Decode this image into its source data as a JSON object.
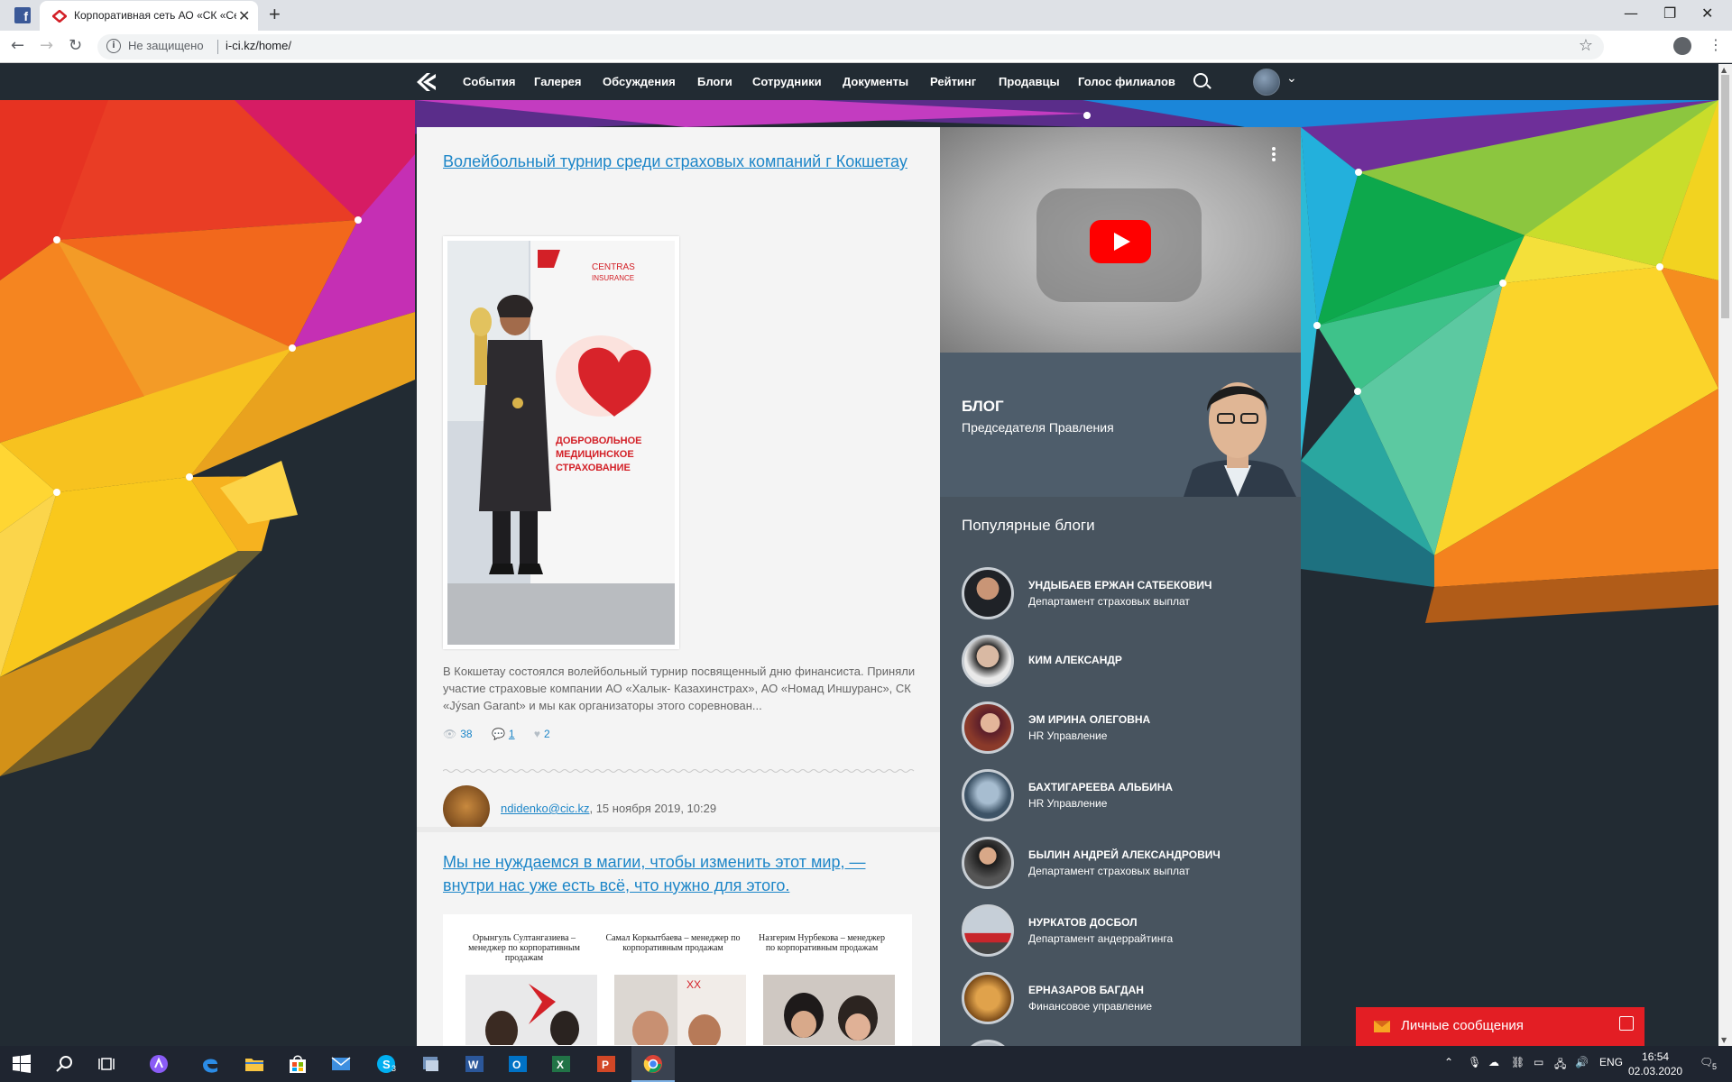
{
  "browser": {
    "tab_title": "Корпоративная сеть АО «СК «Ce",
    "security_label": "Не защищено",
    "url": "i-ci.kz/home/"
  },
  "nav": {
    "items": [
      "События",
      "Галерея",
      "Обсуждения",
      "Блоги",
      "Сотрудники",
      "Документы",
      "Рейтинг",
      "Продавцы",
      "Голос филиалов"
    ]
  },
  "posts": [
    {
      "title": "Волейбольный турнир среди страховых компаний г Кокшетау",
      "excerpt": "В Кокшетау состоялся волейбольный турнир посвященный дню финансиста. Приняли участие страховые компании АО «Халык- Казахинстрах», АО «Номад Иншуранс», СК «Jýsan Garant» и мы как организаторы этого соревнован...",
      "views": "38",
      "comments": "1",
      "likes": "2",
      "author_email": "ndidenko@cic.kz",
      "date": ", 15 ноября 2019, 10:29"
    },
    {
      "title": "Мы не нуждаемся в магии, чтобы изменить этот мир, — внутри нас уже есть всё, что нужно для этого.",
      "people": [
        {
          "caption": "Орынгуль Султангазиева – менеджер по корпоративным продажам"
        },
        {
          "caption": "Самал Коркытбаева – менеджер по корпоративным продажам"
        },
        {
          "caption": "Назгерим Нурбекова – менеджер по корпоративным продажам"
        }
      ]
    }
  ],
  "sidebar": {
    "blog_title": "БЛОГ",
    "blog_subtitle": "Председателя Правления",
    "popular_title": "Популярные блоги",
    "popular": [
      {
        "name": "УНДЫБАЕВ ЕРЖАН САТБЕКОВИЧ",
        "dept": "Департамент страховых выплат"
      },
      {
        "name": "КИМ АЛЕКСАНДР",
        "dept": ""
      },
      {
        "name": "ЭМ ИРИНА ОЛЕГОВНА",
        "dept": "HR Управление"
      },
      {
        "name": "БАХТИГАРЕЕВА АЛЬБИНА",
        "dept": "HR Управление"
      },
      {
        "name": "БЫЛИН АНДРЕЙ АЛЕКСАНДРОВИЧ",
        "dept": "Департамент страховых выплат"
      },
      {
        "name": "НУРКАТОВ ДОСБОЛ",
        "dept": "Департамент андеррайтинга"
      },
      {
        "name": "ЕРНАЗАРОВ БАГДАН",
        "dept": "Финансовое управление"
      }
    ],
    "messages_label": "Личные сообщения"
  },
  "taskbar": {
    "skype_badge": "3",
    "language": "ENG",
    "time": "16:54",
    "date": "02.03.2020",
    "notif_count": "5"
  }
}
